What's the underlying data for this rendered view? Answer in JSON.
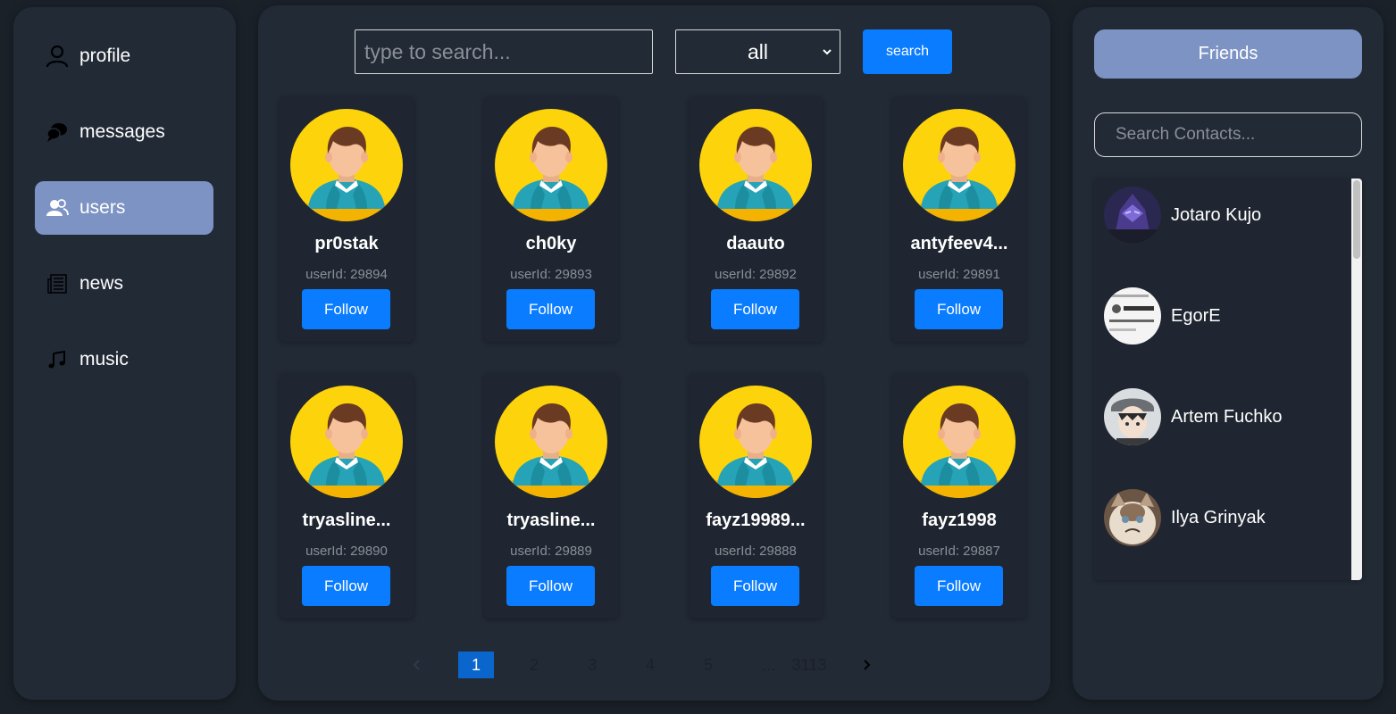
{
  "nav": {
    "items": [
      {
        "label": "profile",
        "icon": "user-icon"
      },
      {
        "label": "messages",
        "icon": "chat-bubbles-icon"
      },
      {
        "label": "users",
        "icon": "users-icon",
        "active": true
      },
      {
        "label": "news",
        "icon": "newspaper-icon"
      },
      {
        "label": "music",
        "icon": "music-note-icon"
      }
    ]
  },
  "search": {
    "placeholder": "type to search...",
    "filter_value": "all",
    "button_label": "search"
  },
  "users": [
    {
      "name": "pr0stak",
      "id_text": "userId: 29894",
      "follow_label": "Follow"
    },
    {
      "name": "ch0ky",
      "id_text": "userId: 29893",
      "follow_label": "Follow"
    },
    {
      "name": "daauto",
      "id_text": "userId: 29892",
      "follow_label": "Follow"
    },
    {
      "name": "antyfeev4...",
      "id_text": "userId: 29891",
      "follow_label": "Follow"
    },
    {
      "name": "tryasline...",
      "id_text": "userId: 29890",
      "follow_label": "Follow"
    },
    {
      "name": "tryasline...",
      "id_text": "userId: 29889",
      "follow_label": "Follow"
    },
    {
      "name": "fayz19989...",
      "id_text": "userId: 29888",
      "follow_label": "Follow"
    },
    {
      "name": "fayz1998",
      "id_text": "userId: 29887",
      "follow_label": "Follow"
    }
  ],
  "pagination": {
    "pages": [
      "1",
      "2",
      "3",
      "4",
      "5"
    ],
    "current": "1",
    "ellipsis": "...",
    "last": "3113"
  },
  "friends": {
    "button_label": "Friends",
    "search_placeholder": "Search Contacts...",
    "contacts": [
      {
        "name": "Jotaro Kujo"
      },
      {
        "name": "EgorE"
      },
      {
        "name": "Artem Fuchko"
      },
      {
        "name": "Ilya Grinyak"
      }
    ]
  },
  "colors": {
    "background": "#1b2129",
    "panel": "#222a36",
    "accent": "#0a7cff",
    "active_nav": "#7d93c4",
    "avatar_yellow": "#fdd30c"
  }
}
